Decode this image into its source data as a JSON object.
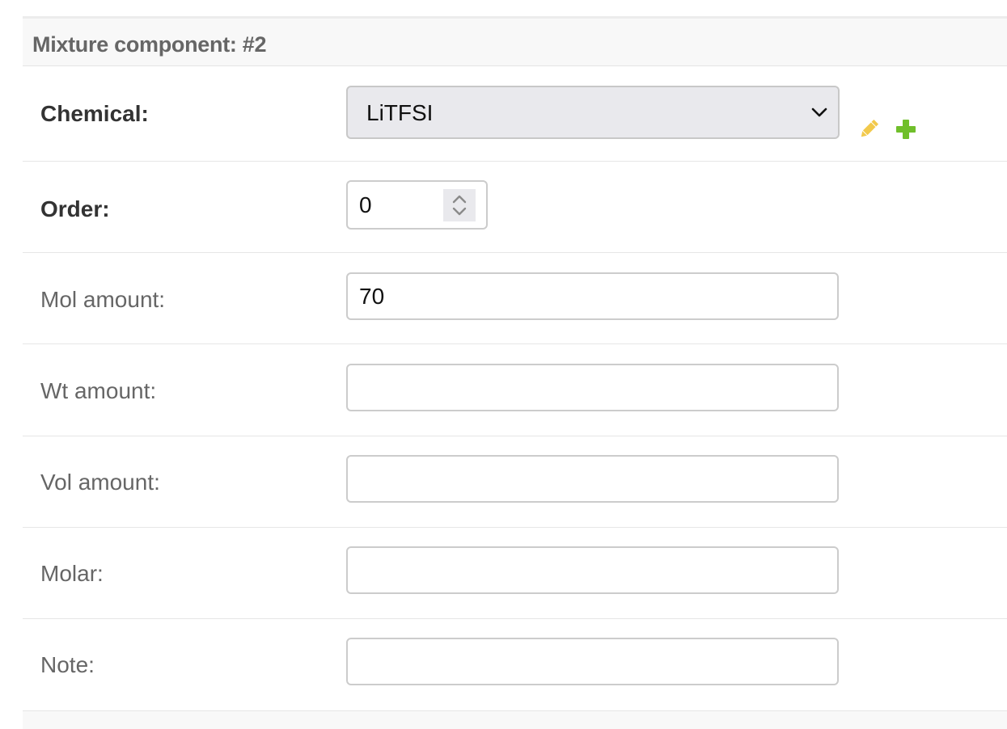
{
  "panel": {
    "title": "Mixture component: #2"
  },
  "fields": {
    "chemical": {
      "label": "Chemical:",
      "selected": "LiTFSI",
      "edit_icon": "pencil-icon",
      "add_icon": "plus-icon"
    },
    "order": {
      "label": "Order:",
      "value": "0"
    },
    "mol_amount": {
      "label": "Mol amount:",
      "value": "70"
    },
    "wt_amount": {
      "label": "Wt amount:",
      "value": ""
    },
    "vol_amount": {
      "label": "Vol amount:",
      "value": ""
    },
    "molar": {
      "label": "Molar:",
      "value": ""
    },
    "note": {
      "label": "Note:",
      "value": ""
    }
  },
  "colors": {
    "edit_icon": "#f2c94c",
    "add_icon": "#70bf2b",
    "required_label": "#333333",
    "optional_label": "#666666"
  }
}
